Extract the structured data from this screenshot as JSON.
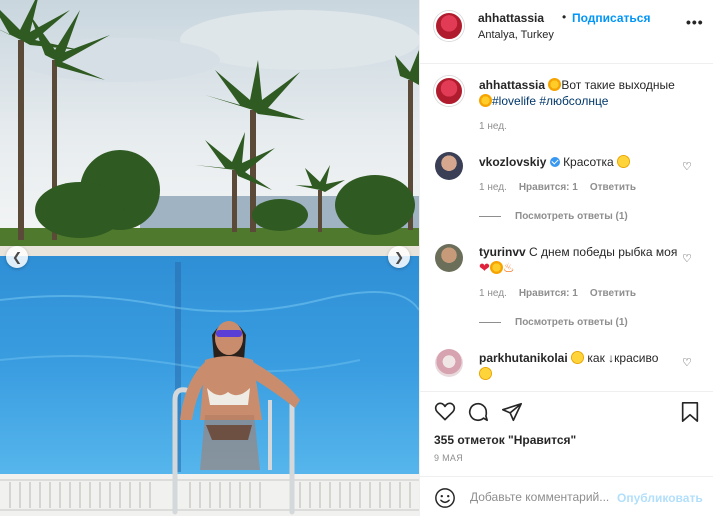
{
  "post": {
    "username": "ahhattassia",
    "follow_label": "Подписаться",
    "separator": "•",
    "location": "Antalya, Turkey",
    "more_label": "•••",
    "caption": {
      "username": "ahhattassia",
      "text_before": "Вот такие выходные",
      "hashtags": "#lovelife #любсолнце",
      "time": "1 нед."
    },
    "likes_label": "355 отметок \"Нравится\"",
    "date": "9 МАЯ"
  },
  "comments": [
    {
      "username": "vkozlovskiy",
      "verified": true,
      "text": "Красотка",
      "time": "1 нед.",
      "likes": "Нравится: 1",
      "reply": "Ответить",
      "view_replies": "Посмотреть ответы (1)"
    },
    {
      "username": "tyurinvv",
      "text": "С днем победы рыбка моя",
      "time": "1 нед.",
      "likes": "Нравится: 1",
      "reply": "Ответить",
      "view_replies": "Посмотреть ответы (1)"
    },
    {
      "username": "parkhutanikolai",
      "text_a": "как",
      "text_b": "красиво"
    }
  ],
  "add_comment": {
    "placeholder": "Добавьте комментарий...",
    "publish_label": "Опубликовать"
  },
  "icons": {
    "like": "heart-icon",
    "comment": "comment-icon",
    "share": "paper-plane-icon",
    "save": "bookmark-icon",
    "emoji": "smiley-icon",
    "prev": "chevron-left-icon",
    "next": "chevron-right-icon"
  },
  "colors": {
    "accent": "#0095f6",
    "hashtag": "#00376b",
    "muted": "#8e8e8e",
    "publish_disabled": "#b2dffc"
  }
}
